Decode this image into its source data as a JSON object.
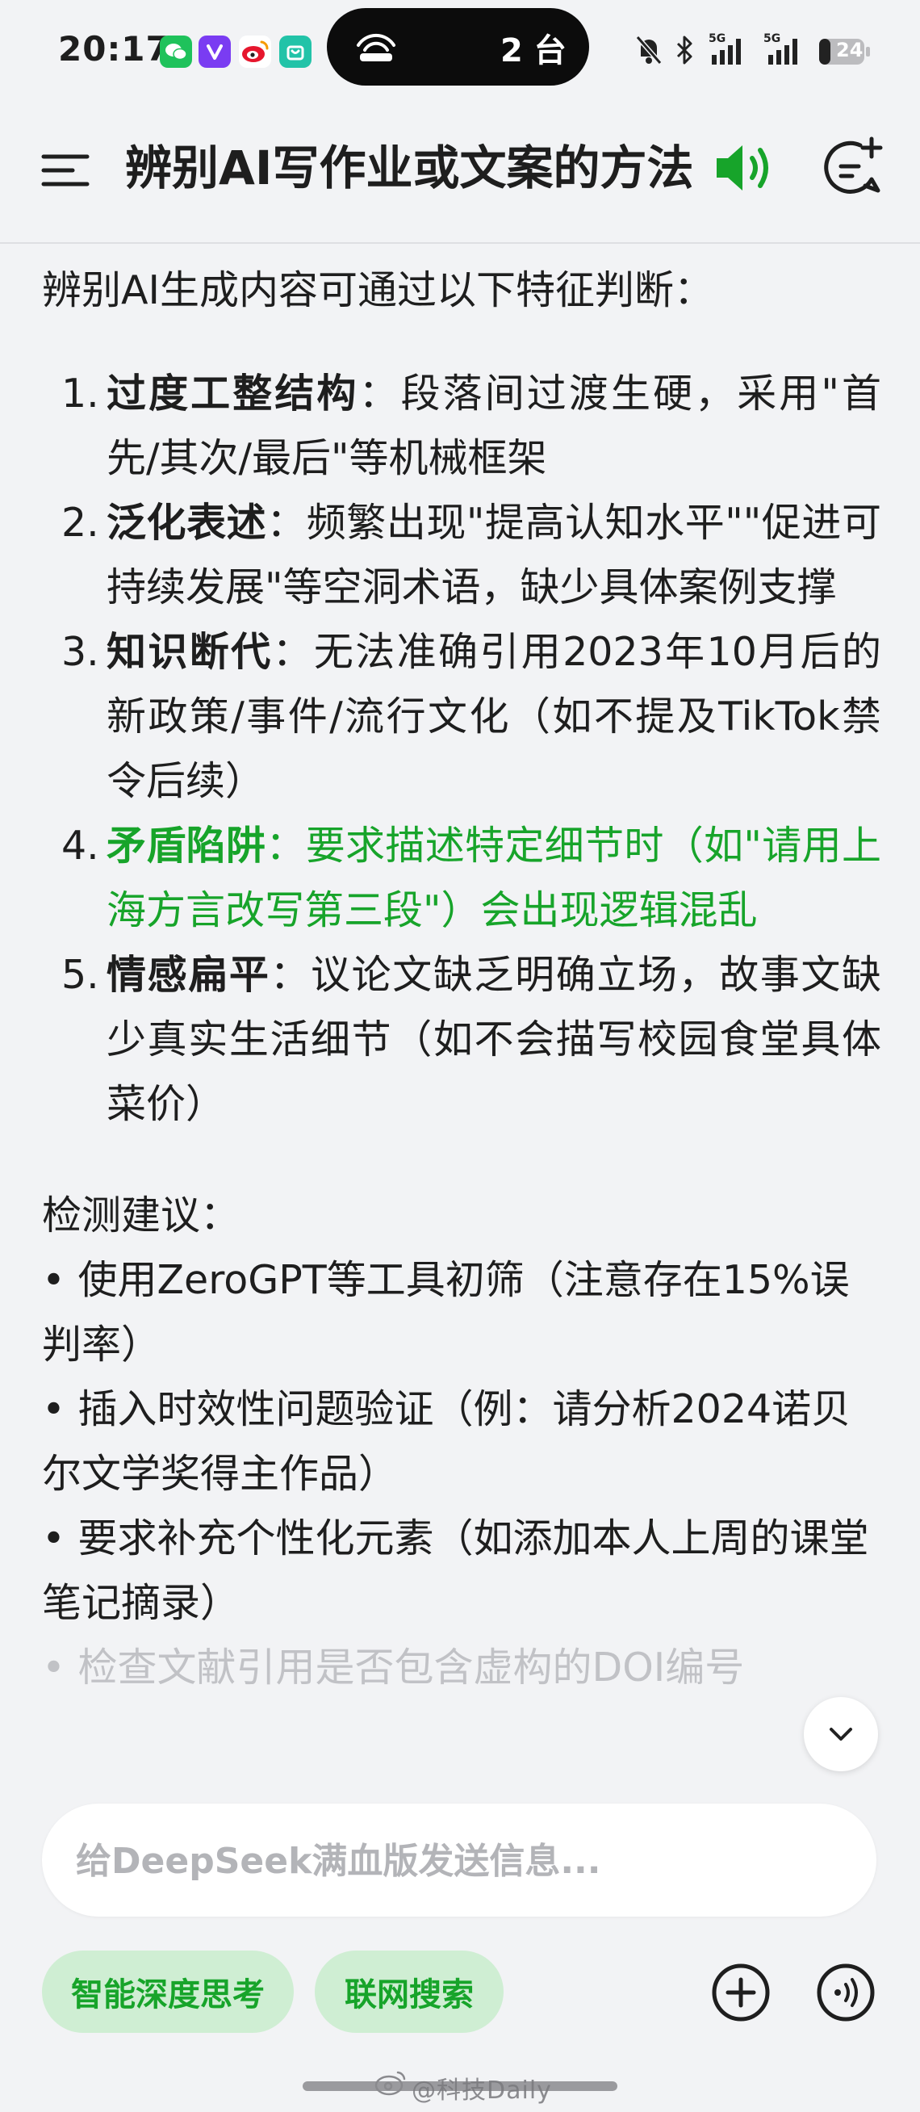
{
  "status_bar": {
    "time": "20:17",
    "device_count": "2 台",
    "battery": "24",
    "network_1": "5G",
    "network_2": "5G"
  },
  "header": {
    "title": "辨别AI写作业或文案的方法"
  },
  "content": {
    "intro": "辨别AI生成内容可通过以下特征判断：",
    "features": [
      {
        "num": "1.",
        "term": "过度工整结构",
        "desc": "：段落间过渡生硬，采用\"首先/其次/最后\"等机械框架"
      },
      {
        "num": "2.",
        "term": "泛化表述",
        "desc": "：频繁出现\"提高认知水平\"\"促进可持续发展\"等空洞术语，缺少具体案例支撑"
      },
      {
        "num": "3.",
        "term": "知识断代",
        "desc": "：无法准确引用2023年10月后的新政策/事件/流行文化（如不提及TikTok禁令后续）"
      },
      {
        "num": "4.",
        "term": "矛盾陷阱",
        "desc": "：要求描述特定细节时（如\"请用上海方言改写第三段\"）会出现逻辑混乱"
      },
      {
        "num": "5.",
        "term": "情感扁平",
        "desc": "：议论文缺乏明确立场，故事文缺少真实生活细节（如不会描写校园食堂具体菜价）"
      }
    ],
    "advice_title": "检测建议：",
    "advice": [
      "• 使用ZeroGPT等工具初筛（注意存在15%误判率）",
      "• 插入时效性问题验证（例：请分析2024诺贝尔文学奖得主作品）",
      "• 要求补充个性化元素（如添加本人上周的课堂笔记摘录）"
    ],
    "faded": "• 检查文献引用是否包含虚构的DOI编号"
  },
  "input": {
    "placeholder": "给DeepSeek满血版发送信息..."
  },
  "chips": {
    "deep_think": "智能深度思考",
    "web_search": "联网搜索"
  },
  "watermark": "@科技Daily",
  "colors": {
    "accent_green": "#17a42a",
    "chip_bg": "#cfeed3",
    "background": "#f2f3f5"
  }
}
